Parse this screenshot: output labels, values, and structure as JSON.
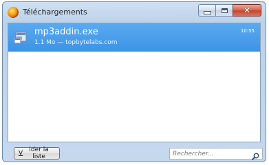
{
  "window": {
    "title": "Téléchargements",
    "app_icon": "firefox-icon",
    "controls": [
      "minimize-icon",
      "maximize-icon",
      "close-icon"
    ],
    "close_glyph": "✕"
  },
  "downloads": [
    {
      "filename": "mp3addin.exe",
      "status": "1.1 Mo — topbytelabs.com",
      "time": "10:55",
      "icon": "executable-file-icon",
      "selected": true
    }
  ],
  "footer": {
    "clear_label_accesskey": "V",
    "clear_label_rest": "ider la liste",
    "search_placeholder": "Rechercher...",
    "search_icon": "search-icon"
  },
  "colors": {
    "selection": "#3d93e6",
    "frame": "#bcd2ea",
    "close_button": "#c24630"
  }
}
